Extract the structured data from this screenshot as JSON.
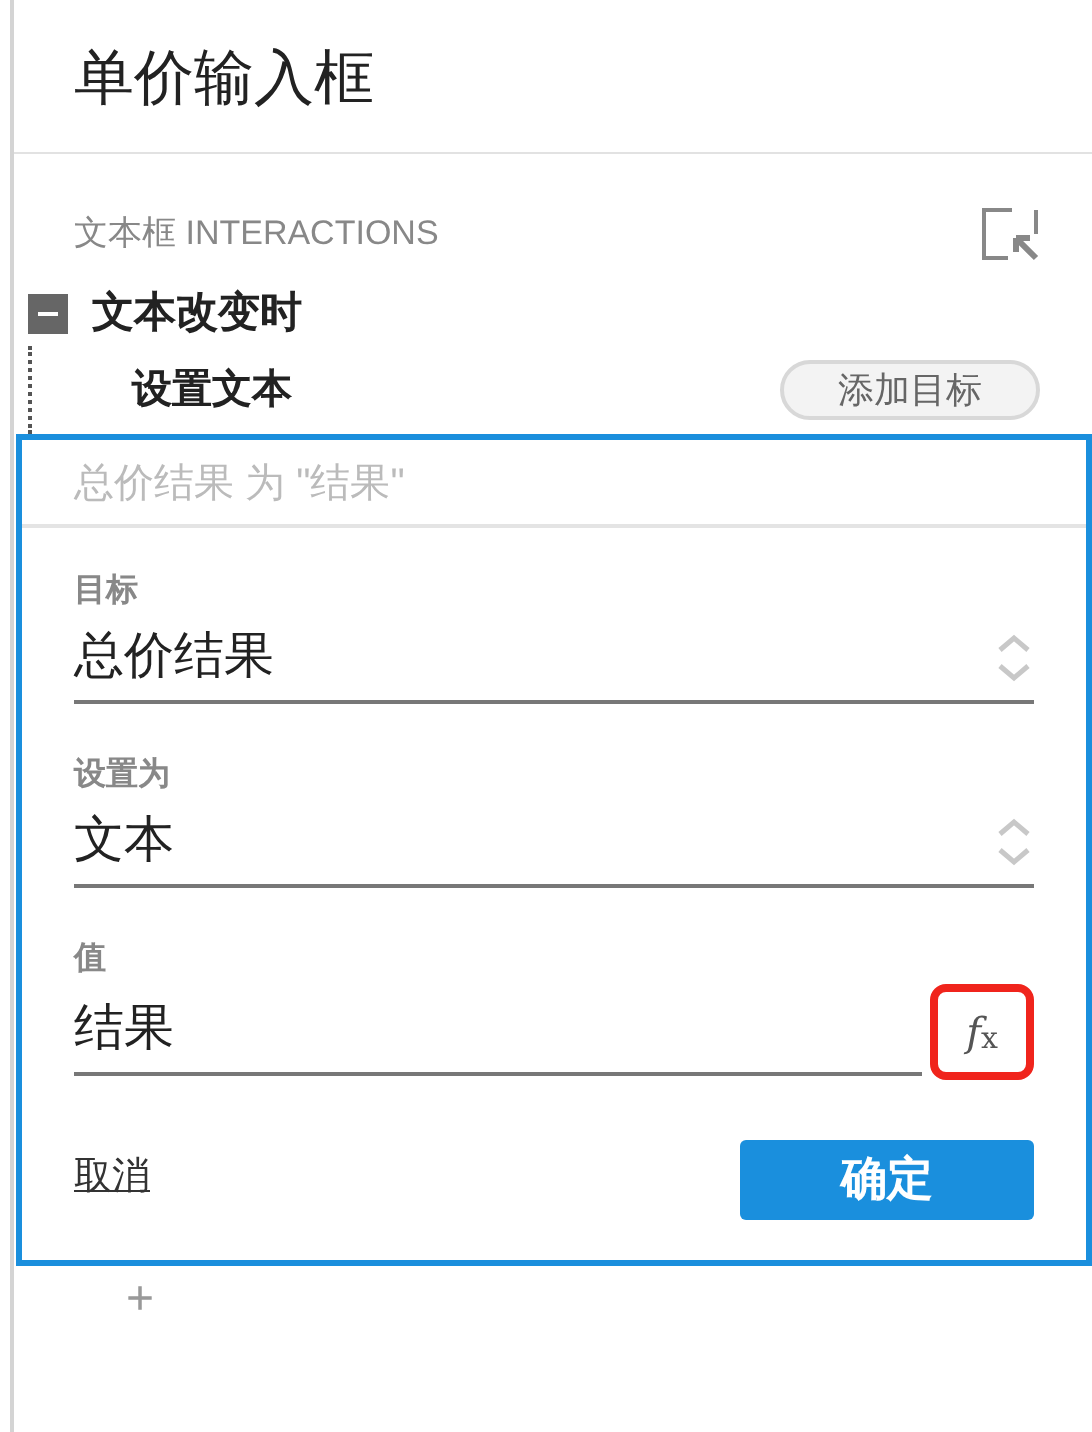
{
  "title": "单价输入框",
  "interactions": {
    "heading": "文本框 INTERACTIONS",
    "event": {
      "label": "文本改变时",
      "expanded": true,
      "action": {
        "label": "设置文本",
        "add_button": "添加目标"
      }
    }
  },
  "editor": {
    "summary": "总价结果 为 \"结果\"",
    "fields": [
      {
        "kind": "select",
        "label": "目标",
        "value": "总价结果"
      },
      {
        "kind": "select",
        "label": "设置为",
        "value": "文本"
      },
      {
        "kind": "formula",
        "label": "值",
        "value": "结果",
        "formula_button": "*f*$_{x}$"
      }
    ],
    "cancel": "取消",
    "confirm": "确定"
  },
  "add_symbol": "+"
}
